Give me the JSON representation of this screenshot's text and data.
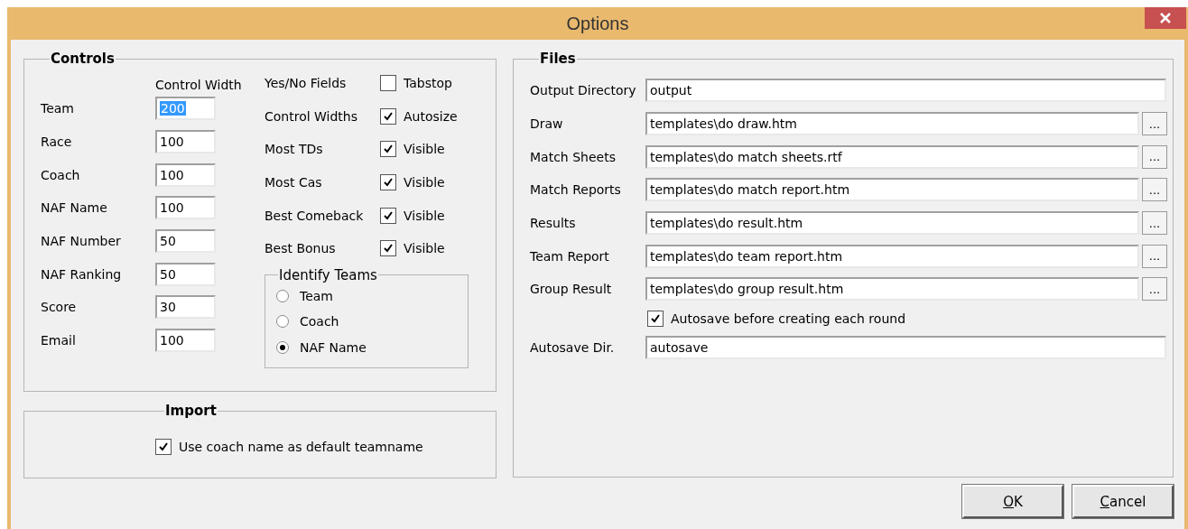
{
  "window": {
    "title": "Options"
  },
  "controls": {
    "legend": "Controls",
    "width_header": "Control Width",
    "widths": [
      {
        "label": "Team",
        "value": "200",
        "selected": true
      },
      {
        "label": "Race",
        "value": "100",
        "selected": false
      },
      {
        "label": "Coach",
        "value": "100",
        "selected": false
      },
      {
        "label": "NAF Name",
        "value": "100",
        "selected": false
      },
      {
        "label": "NAF Number",
        "value": "50",
        "selected": false
      },
      {
        "label": "NAF Ranking",
        "value": "50",
        "selected": false
      },
      {
        "label": "Score",
        "value": "30",
        "selected": false
      },
      {
        "label": "Email",
        "value": "100",
        "selected": false
      }
    ],
    "toggles": [
      {
        "label": "Yes/No Fields",
        "option": "Tabstop",
        "checked": false
      },
      {
        "label": "Control Widths",
        "option": "Autosize",
        "checked": true
      },
      {
        "label": "Most TDs",
        "option": "Visible",
        "checked": true
      },
      {
        "label": "Most Cas",
        "option": "Visible",
        "checked": true
      },
      {
        "label": "Best Comeback",
        "option": "Visible",
        "checked": true
      },
      {
        "label": "Best Bonus",
        "option": "Visible",
        "checked": true
      }
    ],
    "identify_teams": {
      "legend": "Identify Teams",
      "options": [
        {
          "label": "Team",
          "selected": false
        },
        {
          "label": "Coach",
          "selected": false
        },
        {
          "label": "NAF Name",
          "selected": true
        }
      ]
    }
  },
  "import": {
    "legend": "Import",
    "option": {
      "label": "Use coach name as default teamname",
      "checked": true
    }
  },
  "files": {
    "legend": "Files",
    "rows": [
      {
        "kind": "plain",
        "label": "Output Directory",
        "value": "output"
      },
      {
        "kind": "browse",
        "label": "Draw",
        "value": "templates\\do draw.htm",
        "button": "..."
      },
      {
        "kind": "browse",
        "label": "Match Sheets",
        "value": "templates\\do match sheets.rtf",
        "button": "..."
      },
      {
        "kind": "browse",
        "label": "Match Reports",
        "value": "templates\\do match report.htm",
        "button": "..."
      },
      {
        "kind": "browse",
        "label": "Results",
        "value": "templates\\do result.htm",
        "button": "..."
      },
      {
        "kind": "browse",
        "label": "Team Report",
        "value": "templates\\do team report.htm",
        "button": "..."
      },
      {
        "kind": "browse",
        "label": "Group Result",
        "value": "templates\\do group result.htm",
        "button": "..."
      },
      {
        "kind": "check",
        "label": "Autosave before creating each round",
        "checked": true
      },
      {
        "kind": "plain",
        "label": "Autosave Dir.",
        "value": "autosave"
      }
    ]
  },
  "buttons": [
    {
      "accel": "O",
      "rest": "K"
    },
    {
      "accel": "C",
      "rest": "ancel"
    }
  ]
}
